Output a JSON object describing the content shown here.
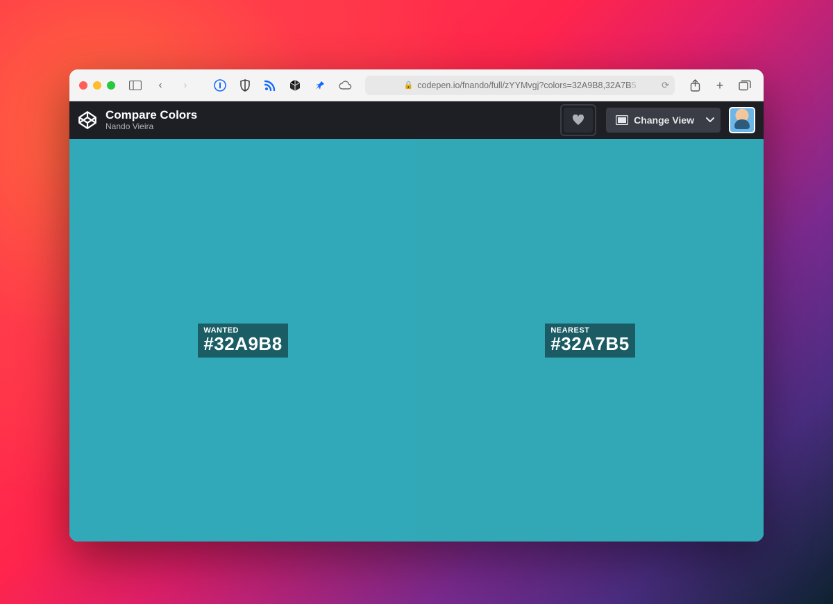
{
  "browser": {
    "url_display": "codepen.io/fnando/full/zYYMvgj?colors=32A9B8,32A7B",
    "url_dim_tail": "5"
  },
  "codepen": {
    "title": "Compare Colors",
    "author": "Nando Vieira",
    "change_view_label": "Change View"
  },
  "colors": {
    "left": {
      "label": "WANTED",
      "hex": "#32A9B8",
      "bg": "#32A9B8"
    },
    "right": {
      "label": "NEAREST",
      "hex": "#32A7B5",
      "bg": "#32A7B5"
    }
  }
}
